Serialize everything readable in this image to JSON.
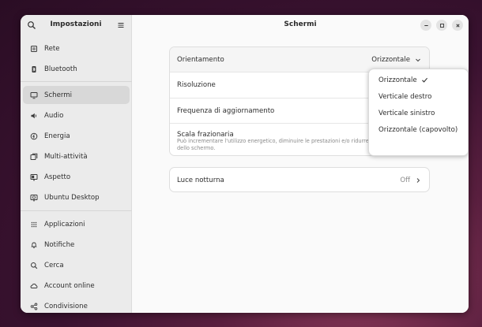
{
  "sidebar": {
    "title": "Impostazioni",
    "items": [
      {
        "label": "Rete",
        "icon": "network-icon"
      },
      {
        "label": "Bluetooth",
        "icon": "bluetooth-icon"
      },
      {
        "label": "Schermi",
        "icon": "display-icon",
        "active": true
      },
      {
        "label": "Audio",
        "icon": "speaker-icon"
      },
      {
        "label": "Energia",
        "icon": "power-icon"
      },
      {
        "label": "Multi-attività",
        "icon": "multitasking-icon"
      },
      {
        "label": "Aspetto",
        "icon": "appearance-icon"
      },
      {
        "label": "Ubuntu Desktop",
        "icon": "ubuntu-desktop-icon"
      },
      {
        "label": "Applicazioni",
        "icon": "apps-grid-icon"
      },
      {
        "label": "Notifiche",
        "icon": "bell-icon"
      },
      {
        "label": "Cerca",
        "icon": "search-icon"
      },
      {
        "label": "Account online",
        "icon": "cloud-icon"
      },
      {
        "label": "Condivisione",
        "icon": "share-icon"
      }
    ]
  },
  "main": {
    "title": "Schermi",
    "settings": {
      "orientation": {
        "label": "Orientamento",
        "value": "Orizzontale"
      },
      "resolution": {
        "label": "Risoluzione"
      },
      "refresh_rate": {
        "label": "Frequenza di aggiornamento"
      },
      "fractional_scaling": {
        "label": "Scala frazionaria",
        "description": "Può incrementare l'utilizzo energetico, diminuire le prestazioni e/o ridurre la precisione dello schermo.",
        "enabled": false
      }
    },
    "night_light": {
      "label": "Luce notturna",
      "value": "Off"
    }
  },
  "orientation_menu": {
    "options": [
      "Orizzontale",
      "Verticale destro",
      "Verticale sinistro",
      "Orizzontale (capovolto)"
    ],
    "selected_index": 0
  },
  "colors": {
    "window_bg": "#fafafa",
    "sidebar_bg": "#ebebeb",
    "active_item": "#d8d8d8",
    "desktop_wallpaper": "#5a1f3f"
  }
}
